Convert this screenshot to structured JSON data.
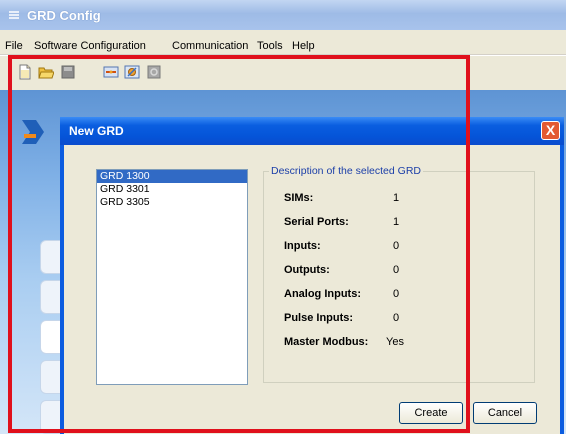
{
  "app": {
    "title": "GRD Config"
  },
  "menu": [
    "File",
    "Software Configuration",
    "Communication",
    "Tools",
    "Help"
  ],
  "toolbar_icons": [
    "new-file-icon",
    "open-folder-icon",
    "save-icon",
    "connect-icon",
    "configure-icon",
    "refresh-icon"
  ],
  "dialog": {
    "title": "New GRD",
    "close_label": "X",
    "devices": [
      "GRD 1300",
      "GRD 3301",
      "GRD 3305"
    ],
    "selected_device": "GRD 1300",
    "description_title": "Description of the selected GRD",
    "properties": [
      {
        "label": "SIMs:",
        "value": "1"
      },
      {
        "label": "Serial Ports:",
        "value": "1"
      },
      {
        "label": "Inputs:",
        "value": "0"
      },
      {
        "label": "Outputs:",
        "value": "0"
      },
      {
        "label": "Analog Inputs:",
        "value": "0"
      },
      {
        "label": "Pulse Inputs:",
        "value": "0"
      },
      {
        "label": "Master Modbus:",
        "value": "Yes"
      }
    ],
    "create_label": "Create",
    "cancel_label": "Cancel"
  },
  "colors": {
    "highlight": "#e0101c",
    "selection": "#316ac5",
    "dialog_frame": "#0b5ce0"
  }
}
